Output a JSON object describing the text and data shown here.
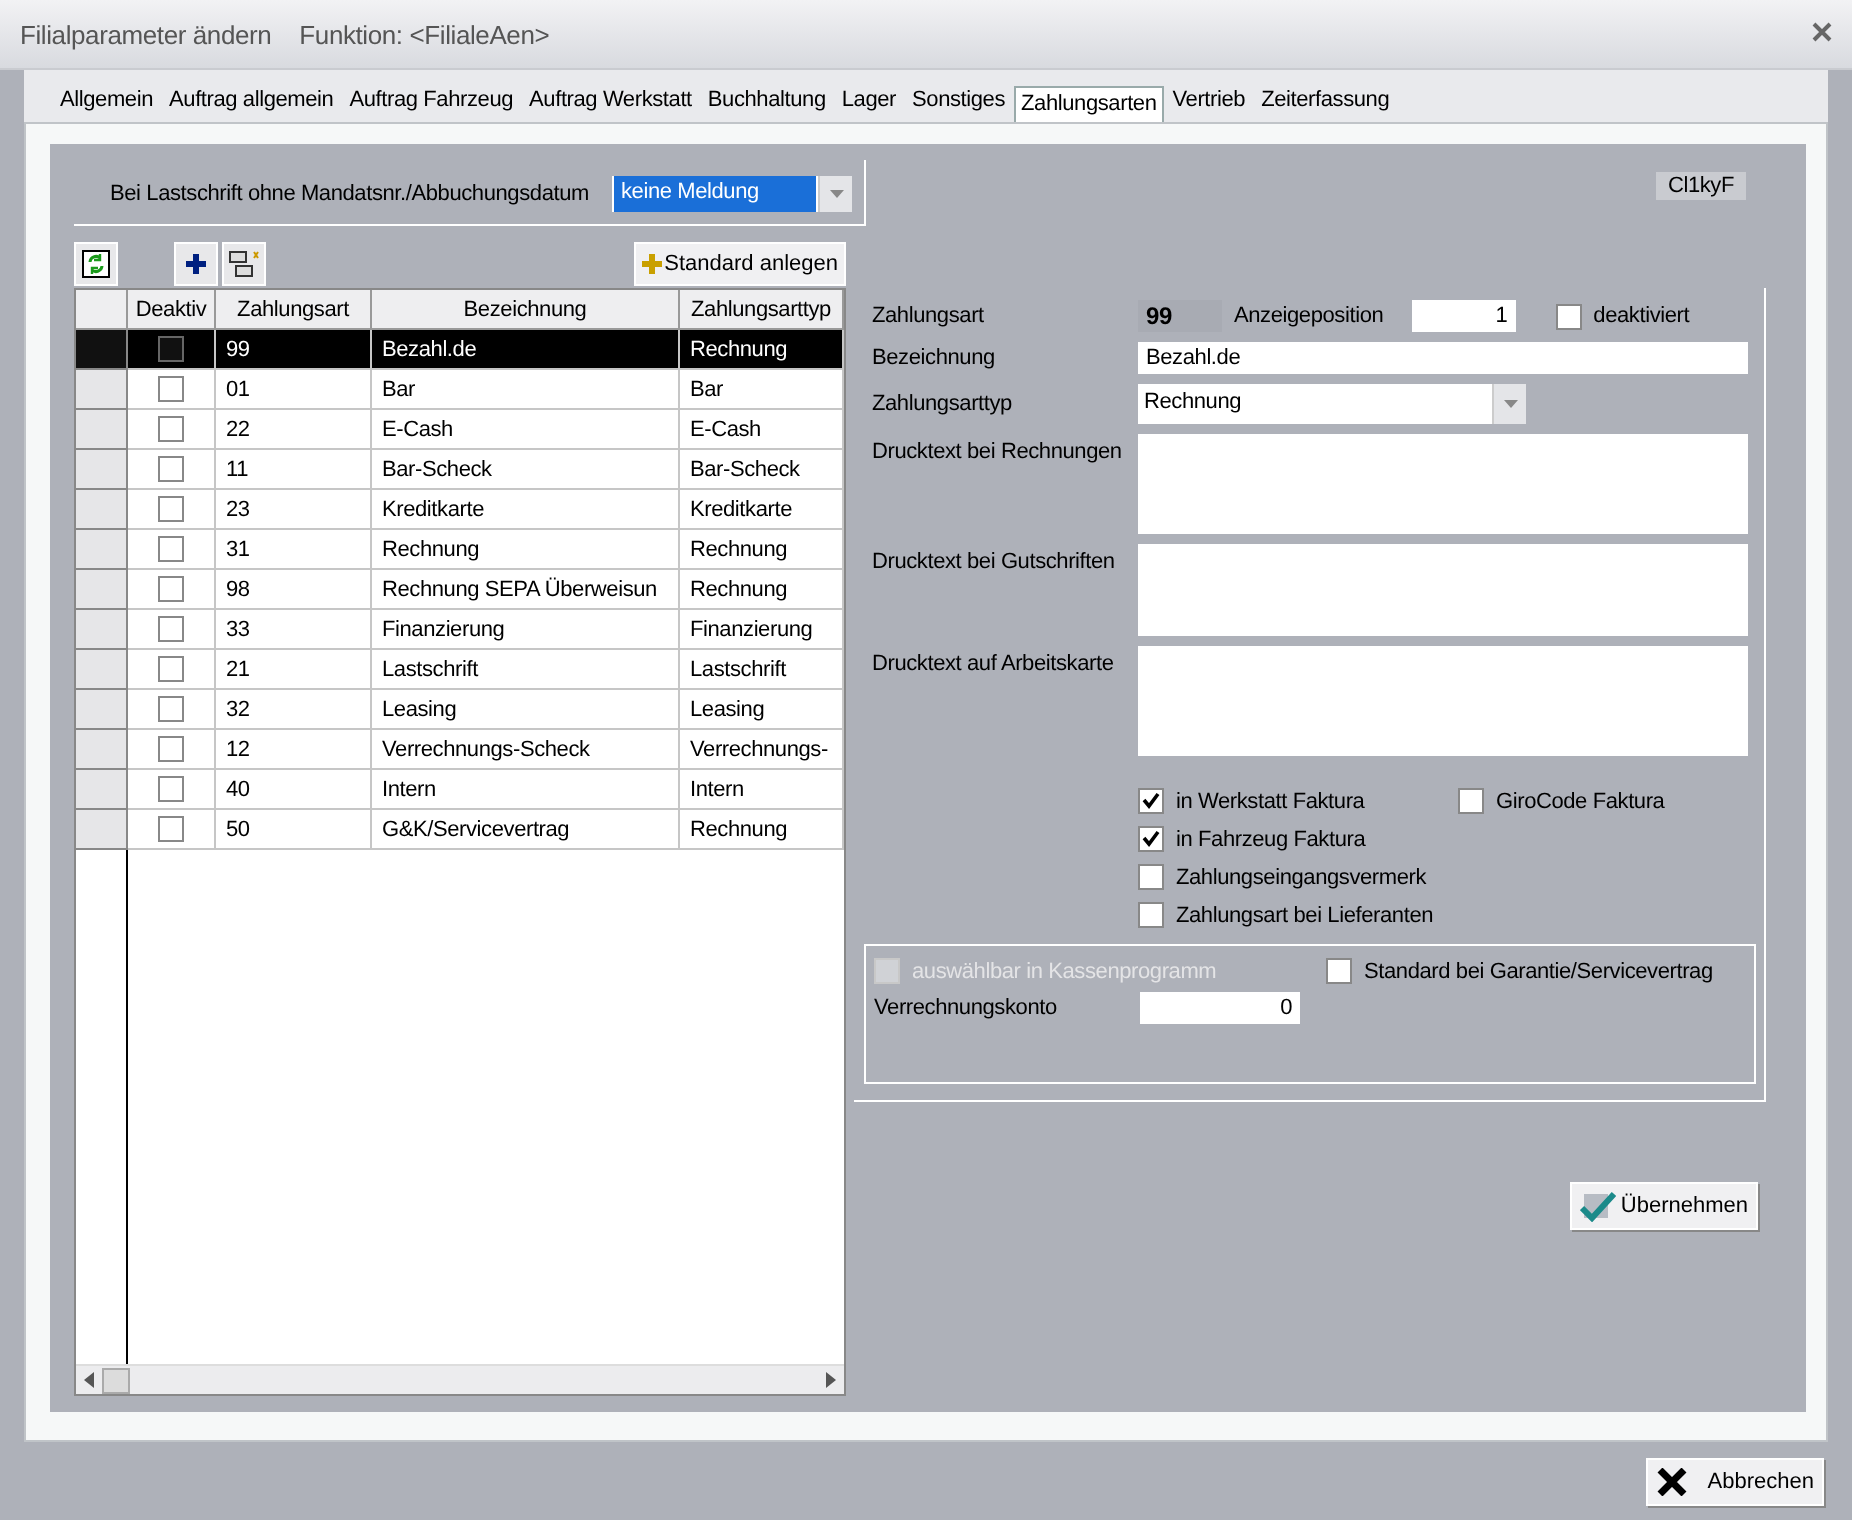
{
  "window": {
    "title": "Filialparameter ändern",
    "function": "Funktion: <FilialeAen>"
  },
  "tabs": [
    {
      "label": "Allgemein",
      "selected": false
    },
    {
      "label": "Auftrag allgemein",
      "selected": false
    },
    {
      "label": "Auftrag Fahrzeug",
      "selected": false
    },
    {
      "label": "Auftrag Werkstatt",
      "selected": false
    },
    {
      "label": "Buchhaltung",
      "selected": false
    },
    {
      "label": "Lager",
      "selected": false
    },
    {
      "label": "Sonstiges",
      "selected": false
    },
    {
      "label": "Zahlungsarten",
      "selected": true
    },
    {
      "label": "Vertrieb",
      "selected": false
    },
    {
      "label": "Zeiterfassung",
      "selected": false
    }
  ],
  "mandate_setting": {
    "label": "Bei Lastschrift ohne Mandatsnr./Abbuchungsdatum",
    "value": "keine Meldung"
  },
  "code": "Cl1kyF",
  "toolbar": {
    "standard_button": "Standard anlegen"
  },
  "table": {
    "columns": [
      "Deaktiv",
      "Zahlungsart",
      "Bezeichnung",
      "Zahlungsarttyp"
    ],
    "rows": [
      {
        "selected": true,
        "deaktiv": false,
        "zahlungsart": "99",
        "bezeichnung": "Bezahl.de",
        "typ": "Rechnung"
      },
      {
        "selected": false,
        "deaktiv": false,
        "zahlungsart": "01",
        "bezeichnung": "Bar",
        "typ": "Bar"
      },
      {
        "selected": false,
        "deaktiv": false,
        "zahlungsart": "22",
        "bezeichnung": "E-Cash",
        "typ": "E-Cash"
      },
      {
        "selected": false,
        "deaktiv": false,
        "zahlungsart": "11",
        "bezeichnung": "Bar-Scheck",
        "typ": "Bar-Scheck"
      },
      {
        "selected": false,
        "deaktiv": false,
        "zahlungsart": "23",
        "bezeichnung": "Kreditkarte",
        "typ": "Kreditkarte"
      },
      {
        "selected": false,
        "deaktiv": false,
        "zahlungsart": "31",
        "bezeichnung": "Rechnung",
        "typ": "Rechnung"
      },
      {
        "selected": false,
        "deaktiv": false,
        "zahlungsart": "98",
        "bezeichnung": "Rechnung SEPA Überweisun",
        "typ": "Rechnung"
      },
      {
        "selected": false,
        "deaktiv": false,
        "zahlungsart": "33",
        "bezeichnung": "Finanzierung",
        "typ": "Finanzierung"
      },
      {
        "selected": false,
        "deaktiv": false,
        "zahlungsart": "21",
        "bezeichnung": "Lastschrift",
        "typ": "Lastschrift"
      },
      {
        "selected": false,
        "deaktiv": false,
        "zahlungsart": "32",
        "bezeichnung": "Leasing",
        "typ": "Leasing"
      },
      {
        "selected": false,
        "deaktiv": false,
        "zahlungsart": "12",
        "bezeichnung": "Verrechnungs-Scheck",
        "typ": "Verrechnungs-"
      },
      {
        "selected": false,
        "deaktiv": false,
        "zahlungsart": "40",
        "bezeichnung": "Intern",
        "typ": "Intern"
      },
      {
        "selected": false,
        "deaktiv": false,
        "zahlungsart": "50",
        "bezeichnung": "G&K/Servicevertrag",
        "typ": "Rechnung"
      }
    ]
  },
  "detail": {
    "zahlungsart_label": "Zahlungsart",
    "zahlungsart_value": "99",
    "position_label": "Anzeigeposition",
    "position_value": "1",
    "deaktiviert": {
      "label": "deaktiviert",
      "checked": false
    },
    "bezeichnung_label": "Bezeichnung",
    "bezeichnung_value": "Bezahl.de",
    "typ_label": "Zahlungsarttyp",
    "typ_value": "Rechnung",
    "texts": [
      "Drucktext bei Rechnungen",
      "Drucktext bei Gutschriften",
      "Drucktext auf Arbeitskarte"
    ],
    "checkboxes": [
      {
        "label": "in Werkstatt Faktura",
        "checked": true
      },
      {
        "label": "in Fahrzeug Faktura",
        "checked": true
      },
      {
        "label": "Zahlungseingangsvermerk",
        "checked": false
      },
      {
        "label": "Zahlungsart bei Lieferanten",
        "checked": false
      },
      {
        "label": "GiroCode Faktura",
        "checked": false
      }
    ],
    "group": {
      "kasse": {
        "label": "auswählbar in Kassenprogramm",
        "checked": false,
        "disabled": true
      },
      "garantie": {
        "label": "Standard bei Garantie/Servicevertrag",
        "checked": false
      },
      "konto_label": "Verrechnungskonto",
      "konto_value": "0"
    }
  },
  "buttons": {
    "apply": "Übernehmen",
    "cancel": "Abbrechen"
  }
}
